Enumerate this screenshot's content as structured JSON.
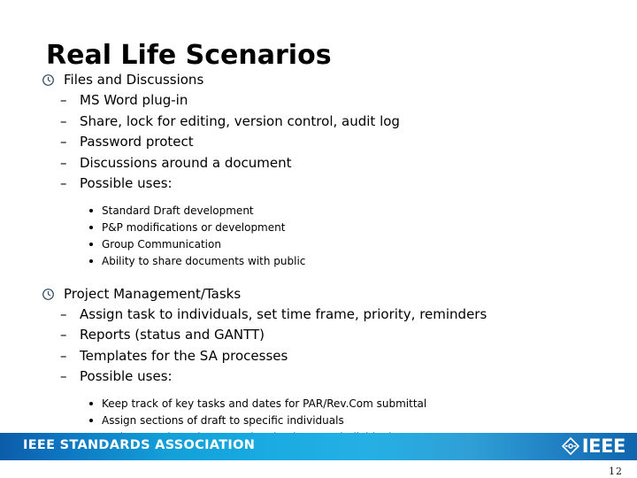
{
  "slide": {
    "title": "Real Life Scenarios",
    "sections": [
      {
        "heading": "Files and Discussions",
        "bullet_icon": "clock-icon",
        "items": [
          "MS Word plug-in",
          "Share, lock for editing, version control, audit log",
          "Password protect",
          "Discussions around a document",
          "Possible uses:"
        ],
        "subitems": [
          "Standard Draft development",
          "P&P modifications or development",
          "Group Communication",
          "Ability to share documents with public"
        ]
      },
      {
        "heading": "Project Management/Tasks",
        "bullet_icon": "clock-icon",
        "items": [
          "Assign task to individuals, set time frame, priority, reminders",
          "Reports (status and GANTT)",
          "Templates for the SA processes",
          "Possible uses:"
        ],
        "subitems": [
          "Keep track of key tasks and dates for PAR/Rev.Com submittal",
          "Assign sections of draft to specific individuals",
          "Assign meeting minutes and action items to individuals"
        ]
      }
    ]
  },
  "footer": {
    "organization": "IEEE STANDARDS ASSOCIATION",
    "logo_text": "IEEE",
    "logo_icon": "ieee-diamond-icon",
    "band_color_left": "#0c5ca8",
    "band_color_mid": "#25b0e4",
    "band_color_right": "#0f65ad"
  },
  "page_number": "12"
}
